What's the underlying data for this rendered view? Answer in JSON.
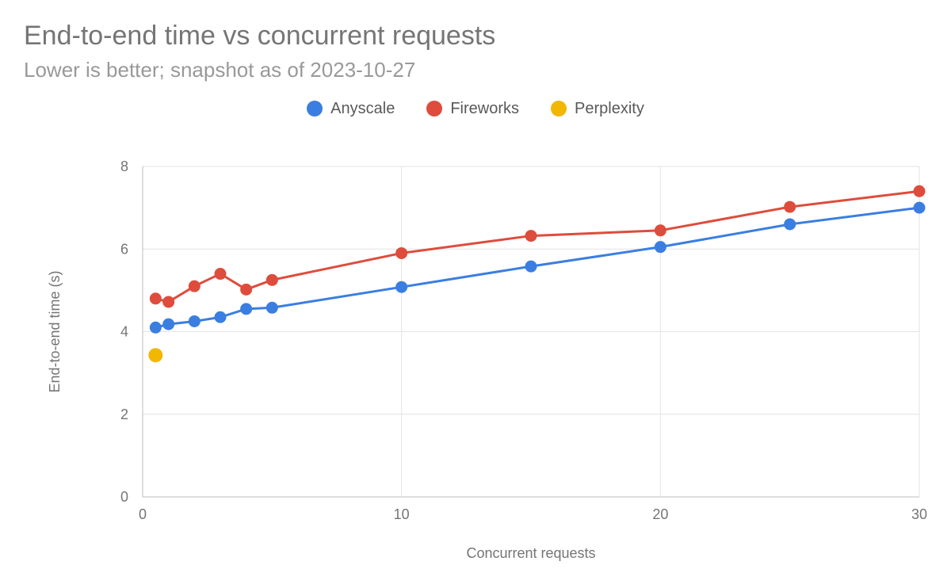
{
  "title": "End-to-end time vs concurrent requests",
  "subtitle": "Lower is better; snapshot as of 2023-10-27",
  "xlabel": "Concurrent requests",
  "ylabel": "End-to-end time (s)",
  "legend": {
    "anyscale": "Anyscale",
    "fireworks": "Fireworks",
    "perplexity": "Perplexity"
  },
  "colors": {
    "anyscale": "#3b7ee1",
    "fireworks": "#de4c3c",
    "perplexity": "#f2b701"
  },
  "chart_data": {
    "type": "line",
    "xlabel": "Concurrent requests",
    "ylabel": "End-to-end time (s)",
    "title": "End-to-end time vs concurrent requests",
    "subtitle": "Lower is better; snapshot as of 2023-10-27",
    "xlim": [
      0,
      30
    ],
    "ylim": [
      0,
      8
    ],
    "xticks": [
      0,
      10,
      20,
      30
    ],
    "yticks": [
      0,
      2,
      4,
      6,
      8
    ],
    "grid": true,
    "legend_position": "top",
    "series": [
      {
        "name": "Anyscale",
        "color": "#3b7ee1",
        "x": [
          0.5,
          1,
          2,
          3,
          4,
          5,
          10,
          15,
          20,
          25,
          30
        ],
        "y": [
          4.1,
          4.18,
          4.25,
          4.35,
          4.55,
          4.58,
          5.08,
          5.58,
          6.05,
          6.6,
          7.0
        ]
      },
      {
        "name": "Fireworks",
        "color": "#de4c3c",
        "x": [
          0.5,
          1,
          2,
          3,
          4,
          5,
          10,
          15,
          20,
          25,
          30
        ],
        "y": [
          4.8,
          4.72,
          5.1,
          5.4,
          5.02,
          5.25,
          5.9,
          6.32,
          6.45,
          7.02,
          7.4
        ]
      },
      {
        "name": "Perplexity",
        "color": "#f2b701",
        "x": [
          0.5
        ],
        "y": [
          3.43
        ]
      }
    ]
  }
}
